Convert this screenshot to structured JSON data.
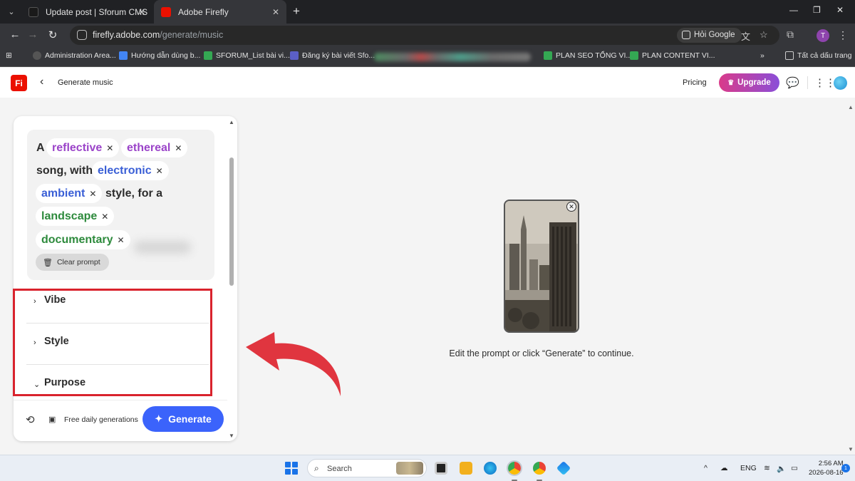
{
  "browser": {
    "tabs": [
      {
        "title": "Update post | Sforum CMS",
        "favicon_color": "#1a1a1a",
        "active": false
      },
      {
        "title": "Adobe Firefly",
        "favicon_color": "#eb1000",
        "active": true
      }
    ],
    "address": {
      "host": "firefly.adobe.com",
      "path": "/generate/music"
    },
    "hoi_google": "Hỏi Google",
    "profile_initial": "T",
    "bookmarks": [
      {
        "label": "Administration Area...",
        "icon_color": "#555555"
      },
      {
        "label": "Hướng dẫn dùng b...",
        "icon_color": "#4285f4"
      },
      {
        "label": "SFORUM_List bài vi...",
        "icon_color": "#34a853"
      },
      {
        "label": "Đăng ký bài viết Sfo...",
        "icon_color": "#5b5fc7"
      },
      {
        "label": "PLAN SEO TỔNG VI...",
        "icon_color": "#34a853"
      },
      {
        "label": "PLAN CONTENT VI...",
        "icon_color": "#34a853"
      }
    ],
    "bookmarks_more": "»",
    "all_bookmarks": "Tất cả dấu trang"
  },
  "app": {
    "logo_text": "Fi",
    "title": "Generate music",
    "pricing": "Pricing",
    "upgrade": "Upgrade",
    "accent": "#3b63fb"
  },
  "prompt": {
    "word_a": "A",
    "chip_reflective": "reflective",
    "chip_ethereal": "ethereal",
    "text_song_with": "song, with",
    "chip_electronic": "electronic",
    "chip_ambient": "ambient",
    "text_style_for_a": "style, for a",
    "chip_landscape": "landscape",
    "chip_documentary": "documentary",
    "clear_label": "Clear prompt"
  },
  "sections": {
    "vibe": "Vibe",
    "style": "Style",
    "purpose": "Purpose"
  },
  "footer": {
    "free_label": "Free daily generations",
    "generate": "Generate"
  },
  "preview": {
    "hint": "Edit the prompt or click “Generate” to continue."
  },
  "taskbar": {
    "search_placeholder": "Search",
    "lang": "ENG",
    "time": "2:56 AM",
    "date": "2026-08-16",
    "badge": "1"
  }
}
